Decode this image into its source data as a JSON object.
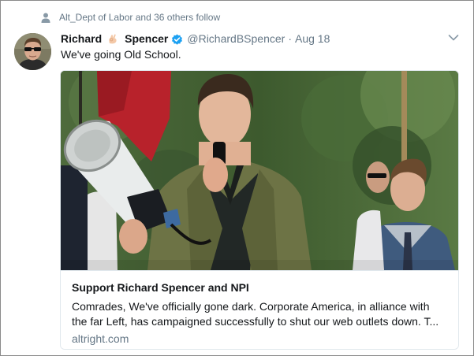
{
  "social_context": {
    "icon": "person-icon",
    "text": "Alt_Dept of Labor and 36 others follow"
  },
  "tweet": {
    "avatar_icon": "avatar",
    "display_name_first": "Richard",
    "display_name_emoji": "ok-hand-emoji",
    "display_name_last": "Spencer",
    "verified_icon": "verified-icon",
    "handle": "@RichardBSpencer",
    "separator": "·",
    "timestamp": "Aug 18",
    "menu_icon": "chevron-down-icon",
    "text": "We've going Old School."
  },
  "card": {
    "image_alt": "man speaking into microphone with megaphone",
    "title": "Support Richard Spencer and NPI",
    "description_line1": "Comrades, We've officially gone dark. Corporate America, in alliance with",
    "description_line2": "the far Left, has campaigned successfully to shut our web outlets down. T...",
    "domain": "altright.com"
  },
  "colors": {
    "text_primary": "#14171a",
    "text_secondary": "#657786",
    "verified_blue": "#1da1f2",
    "border": "#e1e8ed"
  }
}
